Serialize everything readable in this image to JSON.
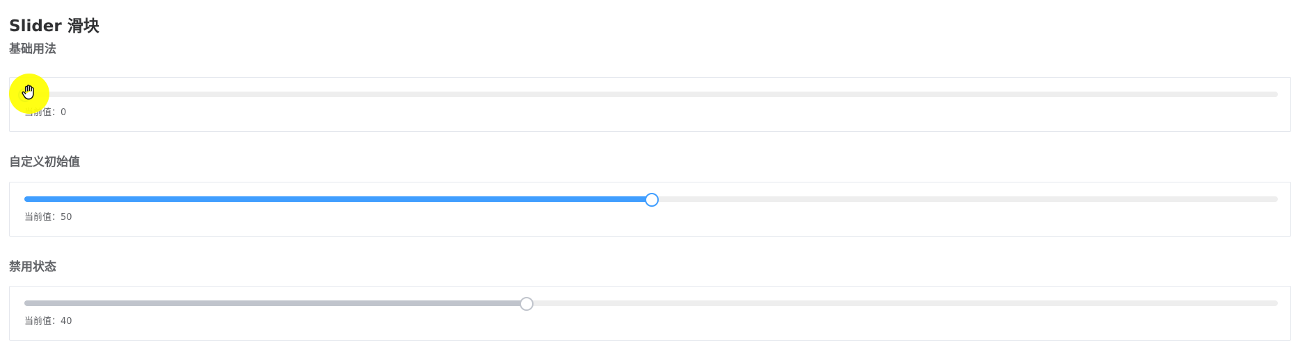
{
  "page": {
    "title": "Slider 滑块"
  },
  "sections": [
    {
      "title": "基础用法",
      "value_prefix": "当前值：",
      "value": "0",
      "fraction": 0.0,
      "disabled": false
    },
    {
      "title": "自定义初始值",
      "value_prefix": "当前值：",
      "value": "50",
      "fraction": 0.5,
      "disabled": false
    },
    {
      "title": "禁用状态",
      "value_prefix": "当前值：",
      "value": "40",
      "fraction": 0.4,
      "disabled": true
    }
  ],
  "colors": {
    "accent": "#409eff",
    "runway": "#eeeeee",
    "disabled": "#c0c4cc",
    "cursor_highlight": "#ffff00"
  },
  "icons": {
    "cursor": "hand-cursor-icon"
  }
}
